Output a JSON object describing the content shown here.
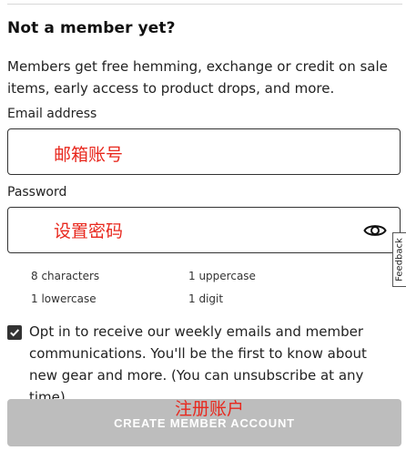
{
  "heading": "Not a member yet?",
  "intro": "Members get free hemming, exchange or credit on sale items, early access to product drops, and more.",
  "email": {
    "label": "Email address",
    "value": "",
    "placeholder": "",
    "annotation": "邮箱账号"
  },
  "password": {
    "label": "Password",
    "value": "",
    "placeholder": "",
    "annotation": "设置密码",
    "toggle_icon": "eye-icon"
  },
  "feedback_tab": "Feedback",
  "requirements": [
    "8 characters",
    "1 uppercase",
    "1 lowercase",
    "1 digit"
  ],
  "optin": {
    "checked": true,
    "text": "Opt in to receive our weekly emails and member communications. You'll be the first to know about new gear and more. (You can unsubscribe at any time)"
  },
  "submit": {
    "label": "CREATE MEMBER ACCOUNT",
    "annotation": "注册账户"
  },
  "colors": {
    "annotation": "#e8281e",
    "button_disabled": "#bdbdbd",
    "checkbox": "#333333",
    "border": "#333333"
  }
}
